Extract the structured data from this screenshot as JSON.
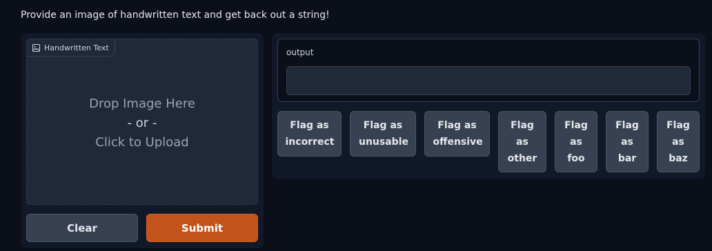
{
  "description": "Provide an image of handwritten text and get back out a string!",
  "image_input": {
    "label": "Handwritten Text",
    "drop_line1": "Drop Image Here",
    "drop_line2": "- or -",
    "drop_line3": "Click to Upload"
  },
  "buttons": {
    "clear": "Clear",
    "submit": "Submit"
  },
  "output": {
    "label": "output",
    "value": ""
  },
  "flags": [
    {
      "label": "Flag as incorrect"
    },
    {
      "label": "Flag as unusable"
    },
    {
      "label": "Flag as offensive"
    },
    {
      "label": "Flag as other"
    },
    {
      "label": "Flag as foo"
    },
    {
      "label": "Flag as bar"
    },
    {
      "label": "Flag as baz"
    }
  ],
  "colors": {
    "background": "#0b0f19",
    "panel": "#111827",
    "submit_accent": "#c2531a"
  }
}
